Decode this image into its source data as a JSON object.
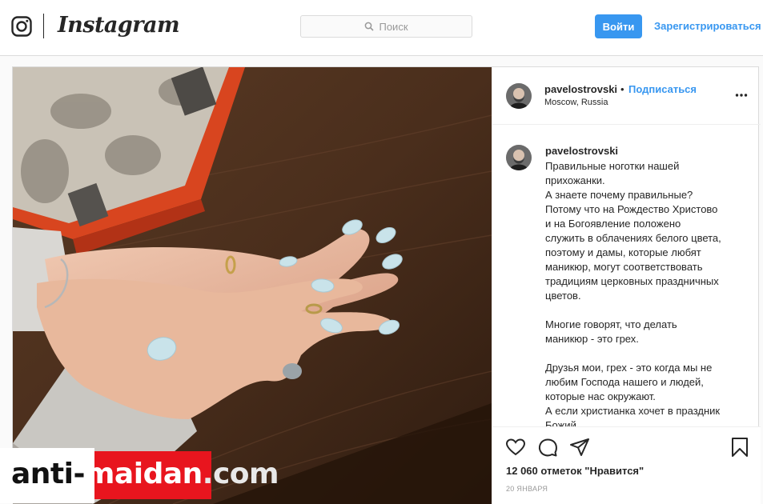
{
  "header": {
    "wordmark": "Instagram",
    "search_placeholder": "Поиск",
    "login_label": "Войти",
    "signup_label": "Зарегистрироваться"
  },
  "post": {
    "username": "pavelostrovski",
    "separator": "•",
    "follow_label": "Подписаться",
    "location": "Moscow, Russia",
    "caption_user": "pavelostrovski",
    "caption": "Правильные ноготки нашей\nприхожанки.\nА знаете почему правильные?\nПотому что на Рождество Христово\nи на Богоявление положено\nслужить в облачениях белого цвета,\nпоэтому и дамы, которые любят\nманикюр, могут соответствовать\nтрадициям церковных праздничных\nцветов.\n\nМногие говорят, что делать\nманикюр - это грех.\n\nДрузья мои, грех - это когда мы не\nлюбим Господа нашего и людей,\nкоторые нас окружают.\nА если христианка хочет в праздник\nБожий",
    "likes": "12 060 отметок \"Нравится\"",
    "date": "20 января"
  },
  "watermark": {
    "part1": "anti-",
    "part2": "maidan",
    "part3": ".com"
  },
  "icons": [
    "instagram-logo-icon",
    "search-icon",
    "more-icon",
    "heart-icon",
    "comment-icon",
    "share-icon",
    "bookmark-icon"
  ],
  "colors": {
    "accent": "#3897f0",
    "border": "#dbdbdb",
    "watermark_red": "#e8151e"
  }
}
